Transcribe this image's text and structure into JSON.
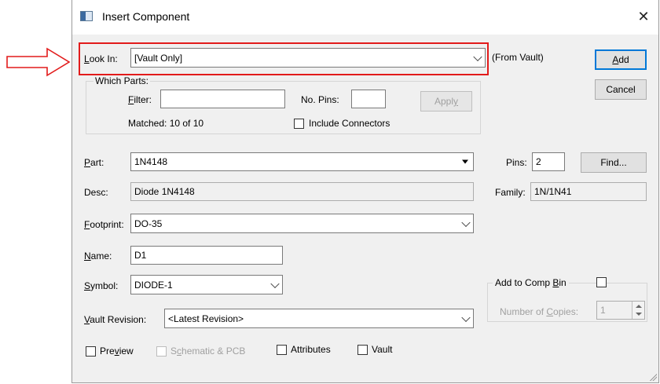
{
  "window": {
    "title": "Insert Component",
    "close_glyph": "✕"
  },
  "look_in": {
    "label_u": "L",
    "label_rest": "ook In:",
    "value": "[Vault Only]",
    "note": "(From Vault)"
  },
  "which_parts": {
    "legend": "Which Parts:",
    "filter_label_u": "F",
    "filter_label_rest": "ilter:",
    "filter_value": "",
    "no_pins_label": "No. Pins:",
    "no_pins_value": "",
    "apply_label_pre": "Appl",
    "apply_label_u": "y",
    "matched": "Matched: 10 of 10",
    "include_connectors": "Include Connectors"
  },
  "buttons": {
    "add_u": "A",
    "add_rest": "dd",
    "cancel": "Cancel",
    "find": "Find..."
  },
  "part": {
    "label_u": "P",
    "label_rest": "art:",
    "value": "1N4148"
  },
  "pins": {
    "label": "Pins:",
    "value": "2"
  },
  "desc": {
    "label": "Desc:",
    "value": "Diode 1N4148"
  },
  "family": {
    "label": "Family:",
    "value": "1N/1N41"
  },
  "footprint": {
    "label_u": "F",
    "label_rest": "ootprint:",
    "value": "DO-35"
  },
  "name": {
    "label_u": "N",
    "label_rest": "ame:",
    "value": "D1"
  },
  "symbol": {
    "label_u": "S",
    "label_rest": "ymbol:",
    "value": "DIODE-1"
  },
  "vault_revision": {
    "label_u": "V",
    "label_rest": "ault Revision:",
    "value": "<Latest Revision>"
  },
  "comp_bin": {
    "label_pre": "Add to Comp ",
    "label_u": "B",
    "label_rest": "in",
    "copies_label_pre": "Number of ",
    "copies_label_u": "C",
    "copies_label_rest": "opies:",
    "copies_value": "1"
  },
  "options": {
    "preview_pre": "Pre",
    "preview_u": "v",
    "preview_rest": "iew",
    "schematic_pre": "S",
    "schematic_u": "c",
    "schematic_rest": "hematic & PCB",
    "attributes": "Attributes",
    "vault": "Vault"
  },
  "colors": {
    "highlight": "#e21b1b",
    "default_button_border": "#0078d7"
  }
}
